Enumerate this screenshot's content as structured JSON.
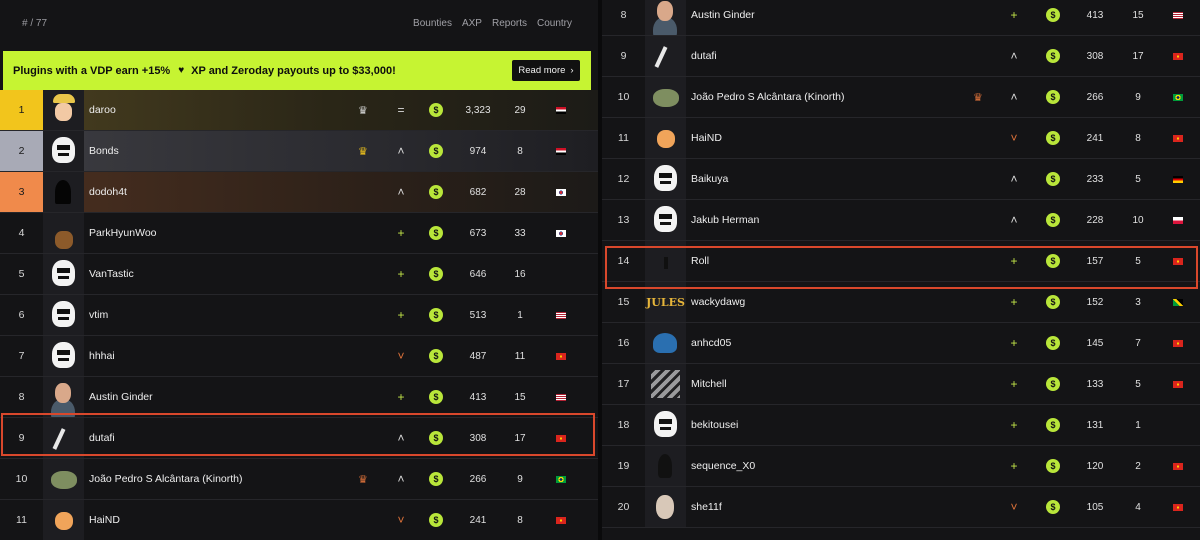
{
  "header": {
    "count": "# / 77",
    "columns": [
      "Bounties",
      "AXP",
      "Reports",
      "Country"
    ]
  },
  "banner": {
    "text_1": "Plugins with a VDP earn +15%",
    "text_2": "XP and Zeroday payouts up to $33,000!",
    "button": "Read more",
    "heart_icon": "heart-icon",
    "arrow_icon": "chevron-right-icon",
    "color": "#c6f432"
  },
  "left_rows": [
    {
      "rank": "1",
      "name": "daroo",
      "trend": "=",
      "xp": "3,323",
      "reports": "29",
      "flag": "egypt",
      "crown": "crown-icon",
      "tier": "gold",
      "avatar": "pirate"
    },
    {
      "rank": "2",
      "name": "Bonds",
      "trend": "^",
      "xp": "974",
      "reports": "8",
      "flag": "egypt",
      "crown": "crown-icon",
      "tier": "silver",
      "avatar": "skull"
    },
    {
      "rank": "3",
      "name": "dodoh4t",
      "trend": "^",
      "xp": "682",
      "reports": "28",
      "flag": "korea",
      "crown": "",
      "tier": "bronze",
      "avatar": "dark"
    },
    {
      "rank": "4",
      "name": "ParkHyunWoo",
      "trend": "+",
      "xp": "673",
      "reports": "33",
      "flag": "korea",
      "crown": "",
      "tier": "",
      "avatar": "night"
    },
    {
      "rank": "5",
      "name": "VanTastic",
      "trend": "+",
      "xp": "646",
      "reports": "16",
      "flag": "",
      "crown": "",
      "tier": "",
      "avatar": "skull"
    },
    {
      "rank": "6",
      "name": "vtim",
      "trend": "+",
      "xp": "513",
      "reports": "1",
      "flag": "usa",
      "crown": "",
      "tier": "",
      "avatar": "skull"
    },
    {
      "rank": "7",
      "name": "hhhai",
      "trend": "v",
      "xp": "487",
      "reports": "11",
      "flag": "vietnam",
      "crown": "",
      "tier": "",
      "avatar": "skull"
    },
    {
      "rank": "8",
      "name": "Austin Ginder",
      "trend": "+",
      "xp": "413",
      "reports": "15",
      "flag": "usa",
      "crown": "",
      "tier": "",
      "avatar": "person"
    },
    {
      "rank": "9",
      "name": "dutafi",
      "trend": "^",
      "xp": "308",
      "reports": "17",
      "flag": "vietnam",
      "crown": "",
      "tier": "",
      "avatar": "teal"
    },
    {
      "rank": "10",
      "name": "João Pedro S Alcântara (Kinorth)",
      "trend": "^",
      "xp": "266",
      "reports": "9",
      "flag": "brazil",
      "crown": "crown-icon",
      "tier": "",
      "avatar": "frog"
    },
    {
      "rank": "11",
      "name": "HaiND",
      "trend": "v",
      "xp": "241",
      "reports": "8",
      "flag": "vietnam",
      "crown": "",
      "tier": "",
      "avatar": "cat"
    }
  ],
  "right_rows": [
    {
      "rank": "8",
      "name": "Austin Ginder",
      "trend": "+",
      "xp": "413",
      "reports": "15",
      "flag": "usa",
      "crown": "",
      "avatar": "person"
    },
    {
      "rank": "9",
      "name": "dutafi",
      "trend": "^",
      "xp": "308",
      "reports": "17",
      "flag": "vietnam",
      "crown": "",
      "avatar": "teal"
    },
    {
      "rank": "10",
      "name": "João Pedro S Alcântara (Kinorth)",
      "trend": "^",
      "xp": "266",
      "reports": "9",
      "flag": "brazil",
      "crown": "crown-icon",
      "avatar": "frog"
    },
    {
      "rank": "11",
      "name": "HaiND",
      "trend": "v",
      "xp": "241",
      "reports": "8",
      "flag": "vietnam",
      "crown": "",
      "avatar": "cat"
    },
    {
      "rank": "12",
      "name": "Baikuya",
      "trend": "^",
      "xp": "233",
      "reports": "5",
      "flag": "germany",
      "crown": "",
      "avatar": "skull"
    },
    {
      "rank": "13",
      "name": "Jakub Herman",
      "trend": "^",
      "xp": "228",
      "reports": "10",
      "flag": "poland",
      "crown": "",
      "avatar": "skull"
    },
    {
      "rank": "14",
      "name": "Roll",
      "trend": "+",
      "xp": "157",
      "reports": "5",
      "flag": "vietnam",
      "crown": "",
      "avatar": "sunset"
    },
    {
      "rank": "15",
      "name": "wackydawg",
      "trend": "+",
      "xp": "152",
      "reports": "3",
      "flag": "jamaica",
      "crown": "",
      "avatar": "jules",
      "avatar_text": "JULES"
    },
    {
      "rank": "16",
      "name": "anhcd05",
      "trend": "+",
      "xp": "145",
      "reports": "7",
      "flag": "vietnam",
      "crown": "",
      "avatar": "shark"
    },
    {
      "rank": "17",
      "name": "Mitchell",
      "trend": "+",
      "xp": "133",
      "reports": "5",
      "flag": "vietnam",
      "crown": "",
      "avatar": "manga"
    },
    {
      "rank": "18",
      "name": "bekitousei",
      "trend": "+",
      "xp": "131",
      "reports": "1",
      "flag": "",
      "crown": "",
      "avatar": "skull"
    },
    {
      "rank": "19",
      "name": "sequence_X0",
      "trend": "+",
      "xp": "120",
      "reports": "2",
      "flag": "vietnam",
      "crown": "",
      "avatar": "silhouette"
    },
    {
      "rank": "20",
      "name": "she11f",
      "trend": "v",
      "xp": "105",
      "reports": "4",
      "flag": "vietnam",
      "crown": "",
      "avatar": "anime"
    }
  ],
  "icons": {
    "coin": "dollar-coin-icon",
    "up": "chevron-up-icon",
    "down": "chevron-down-icon",
    "new": "plus-icon",
    "same": "equals-icon"
  },
  "colors": {
    "accent": "#c6f432",
    "gold": "#f2c51c",
    "silver": "#a8aab6",
    "bronze": "#f08a4b",
    "highlight": "#d9482c",
    "down_trend": "#e0733a"
  }
}
